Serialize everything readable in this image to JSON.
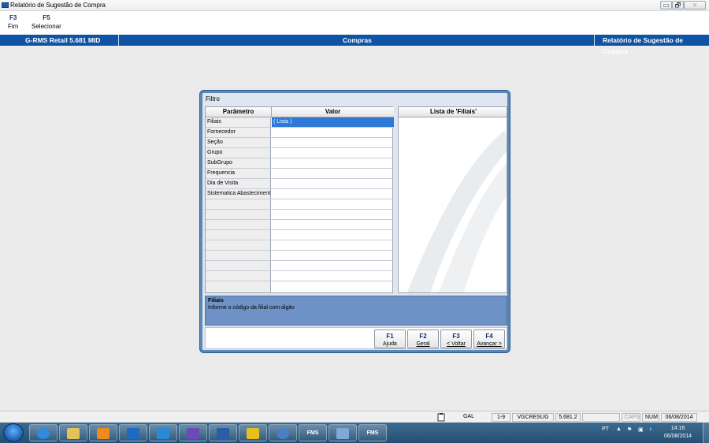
{
  "window": {
    "title": "Relatório de Sugestão de Compra",
    "controls": [
      "▭",
      "🗗",
      "✕"
    ]
  },
  "toolbar": {
    "keys": [
      {
        "key": "F3",
        "label": "Fim"
      },
      {
        "key": "F5",
        "label": "Selecionar"
      }
    ]
  },
  "header": {
    "product": "G-RMS Retail 5.681 MID",
    "module": "Compras",
    "report": "Relatório de Sugestão de Compra"
  },
  "dialog": {
    "title": "Filtro",
    "columns": {
      "param": "Parâmetro",
      "value": "Valor"
    },
    "rows": [
      {
        "param": "Filiais",
        "value": "( Lista )"
      },
      {
        "param": "Fornecedor",
        "value": ""
      },
      {
        "param": "Seção",
        "value": ""
      },
      {
        "param": "Grupo",
        "value": ""
      },
      {
        "param": "SubGrupo",
        "value": ""
      },
      {
        "param": "Frequencia",
        "value": ""
      },
      {
        "param": "Dia de Visita",
        "value": ""
      },
      {
        "param": "Sistematica Abastecimento",
        "value": ""
      }
    ],
    "list_title": "Lista de 'Filiais'",
    "help": {
      "title": "Filiais",
      "text": "Informe o código da filial com digito"
    },
    "buttons": [
      {
        "key": "F1",
        "label": "Ajuda"
      },
      {
        "key": "F2",
        "label": "Geral"
      },
      {
        "key": "F3",
        "label": "< Voltar"
      },
      {
        "key": "F4",
        "label": "Avançar >"
      }
    ]
  },
  "statusbar": {
    "cells": [
      "GAL",
      "1-9",
      "VGCRESUG",
      "5.681.2",
      "",
      "CAPS",
      "NUM",
      "06/08/2014"
    ]
  },
  "taskbar": {
    "apps": [
      "FMS",
      "FMS"
    ],
    "tray_lang": "PT",
    "time": "14:16",
    "date": "06/08/2014"
  }
}
